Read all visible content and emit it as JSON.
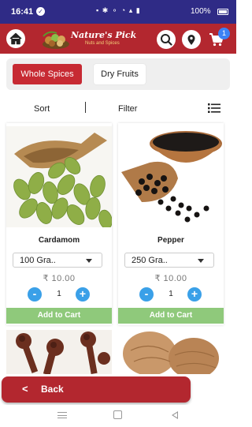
{
  "status_bar": {
    "time": "16:41",
    "battery": "100%",
    "icons": [
      "notification-icon",
      "wifi-icon",
      "signal-icon",
      "battery-icon"
    ]
  },
  "app_bar": {
    "brand": "Nature's Pick",
    "tagline": "Nuts and Spices",
    "cart_count": "1",
    "colors": {
      "bar": "#b3272f",
      "badge": "#3b82f6"
    }
  },
  "tabs": [
    {
      "label": "Whole Spices",
      "active": true
    },
    {
      "label": "Dry Fruits",
      "active": false
    }
  ],
  "toolbar": {
    "sort_label": "Sort",
    "filter_label": "Filter"
  },
  "products": [
    {
      "name": "Cardamom",
      "weight_option": "100 Gra..",
      "price": "₹ 10.00",
      "quantity": "1",
      "minus_label": "-",
      "plus_label": "+",
      "add_label": "Add to Cart"
    },
    {
      "name": "Pepper",
      "weight_option": "250 Gra..",
      "price": "₹ 10.00",
      "quantity": "1",
      "minus_label": "-",
      "plus_label": "+",
      "add_label": "Add to Cart"
    }
  ],
  "back_button": {
    "arrow": "<",
    "label": "Back"
  },
  "colors": {
    "accent": "#b3272f",
    "add_to_cart": "#8fc97b",
    "stepper": "#3aa0e8"
  }
}
